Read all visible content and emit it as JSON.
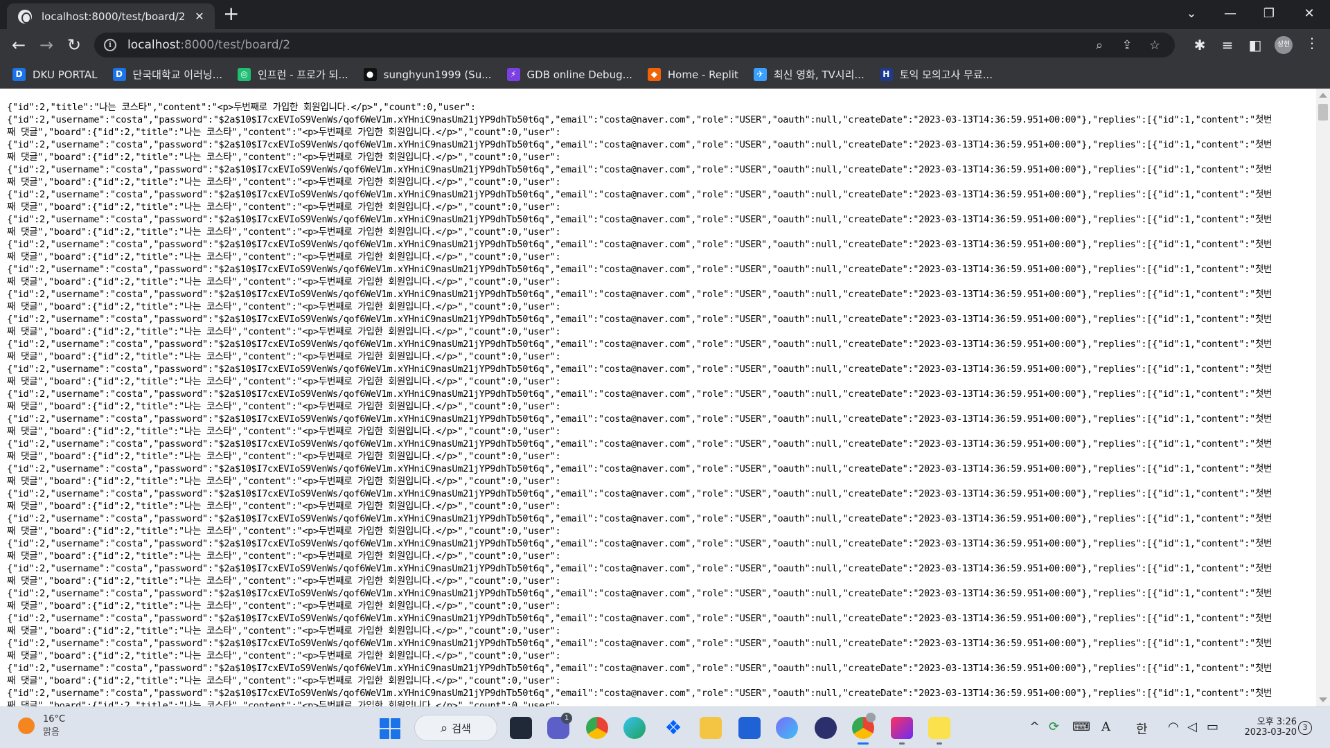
{
  "window": {
    "tab_title": "localhost:8000/test/board/2",
    "url_host": "localhost",
    "url_path": ":8000/test/board/2"
  },
  "bookmarks": [
    {
      "label": "DKU PORTAL",
      "icon": "dku-logo-icon",
      "color": "#1a73e8",
      "glyph": "D"
    },
    {
      "label": "단국대학교 이러닝...",
      "icon": "dku-logo-icon",
      "color": "#1a73e8",
      "glyph": "D"
    },
    {
      "label": "인프런 - 프로가 되...",
      "icon": "inflearn-icon",
      "color": "#1fbf73",
      "glyph": "◎"
    },
    {
      "label": "sunghyun1999 (Su...",
      "icon": "github-icon",
      "color": "#111111",
      "glyph": "●"
    },
    {
      "label": "GDB online Debug...",
      "icon": "gdb-icon",
      "color": "#7b3fe4",
      "glyph": "⚡"
    },
    {
      "label": "Home - Replit",
      "icon": "replit-icon",
      "color": "#f26207",
      "glyph": "◆"
    },
    {
      "label": "최신 영화, TV시리...",
      "icon": "movie-site-icon",
      "color": "#3aa0ff",
      "glyph": "✈"
    },
    {
      "label": "토익 모의고사 무료...",
      "icon": "hackers-icon",
      "color": "#1e3a8a",
      "glyph": "H"
    }
  ],
  "json_text": {
    "first_line": "{\"id\":2,\"title\":\"나는 코스타\",\"content\":\"<p>두번째로 가입한 회원입니다.</p>\",\"count\":0,\"user\":",
    "user_line": "{\"id\":2,\"username\":\"costa\",\"password\":\"$2a$10$I7cxEVIoS9VenWs/qof6WeV1m.xYHniC9nasUm21jYP9dhTb50t6q\",\"email\":\"costa@naver.com\",\"role\":\"USER\",\"oauth\":null,\"createDate\":\"2023-03-13T14:36:59.951+00:00\"},\"replies\":[{\"id\":1,\"content\":\"첫번",
    "reply_line": "째 댓글\",\"board\":{\"id\":2,\"title\":\"나는 코스타\",\"content\":\"<p>두번째로 가입한 회원입니다.</p>\",\"count\":0,\"user\":",
    "repeat_pairs": 24
  },
  "taskbar": {
    "weather_temp": "16°C",
    "weather_desc": "맑음",
    "search_label": "검색",
    "teams_badge": "1",
    "ime": "한",
    "font_indicator": "A",
    "clock_time": "오후 3:26",
    "clock_date": "2023-03-20",
    "notifications": "3"
  },
  "colors": {
    "tabstrip": "#202124",
    "toolbar": "#35363a",
    "taskbar": "#dde3ed"
  }
}
